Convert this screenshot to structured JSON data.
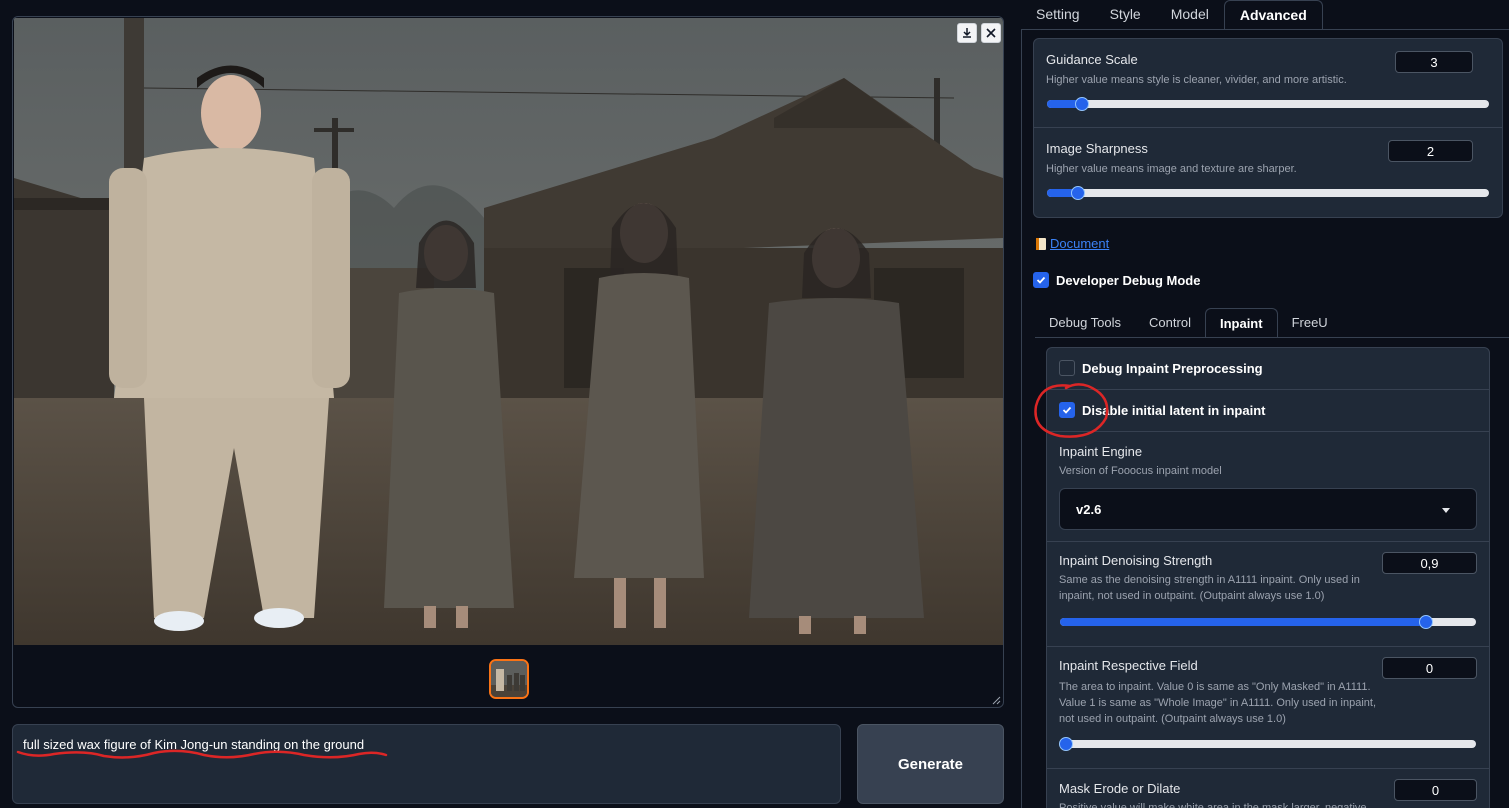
{
  "gallery": {
    "download_icon": "download-icon",
    "close_icon": "close-icon",
    "thumbnail_selected": true
  },
  "prompt": {
    "text": "full sized wax figure of Kim Jong-un standing on the ground",
    "annotation_color": "#dc2626"
  },
  "generate": {
    "label": "Generate"
  },
  "tabs": [
    {
      "label": "Setting",
      "active": false
    },
    {
      "label": "Style",
      "active": false
    },
    {
      "label": "Model",
      "active": false
    },
    {
      "label": "Advanced",
      "active": true
    }
  ],
  "guidance": {
    "label": "Guidance Scale",
    "desc": "Higher value means style is cleaner, vivider, and more artistic.",
    "value": "3",
    "fraction": 0.08
  },
  "sharpness": {
    "label": "Image Sharpness",
    "desc": "Higher value means image and texture are sharper.",
    "value": "2",
    "fraction": 0.07
  },
  "document": {
    "label": "Document",
    "icon": "document-icon"
  },
  "debug_mode": {
    "label": "Developer Debug Mode",
    "checked": true
  },
  "subtabs": [
    {
      "label": "Debug Tools",
      "active": false
    },
    {
      "label": "Control",
      "active": false
    },
    {
      "label": "Inpaint",
      "active": true
    },
    {
      "label": "FreeU",
      "active": false
    }
  ],
  "inpaint": {
    "debug_preprocessing": {
      "label": "Debug Inpaint Preprocessing",
      "checked": false
    },
    "disable_latent": {
      "label": "Disable initial latent in inpaint",
      "checked": true
    },
    "engine": {
      "label": "Inpaint Engine",
      "desc": "Version of Fooocus inpaint model",
      "value": "v2.6"
    },
    "denoising": {
      "label": "Inpaint Denoising Strength",
      "desc": "Same as the denoising strength in A1111 inpaint. Only used in inpaint, not used in outpaint. (Outpaint always use 1.0)",
      "value": "0,9",
      "fraction": 0.9
    },
    "respective": {
      "label": "Inpaint Respective Field",
      "desc": "The area to inpaint. Value 0 is same as \"Only Masked\" in A1111. Value 1 is same as \"Whole Image\" in A1111. Only used in inpaint, not used in outpaint. (Outpaint always use 1.0)",
      "value": "0",
      "fraction": 0.0
    },
    "erode": {
      "label": "Mask Erode or Dilate",
      "desc": "Positive value will make white area in the mask larger, negative value will make white area smaller.",
      "value": "0"
    }
  },
  "colors": {
    "accent": "#2563eb",
    "thumb_border": "#f97316",
    "annotation": "#dc2626"
  }
}
